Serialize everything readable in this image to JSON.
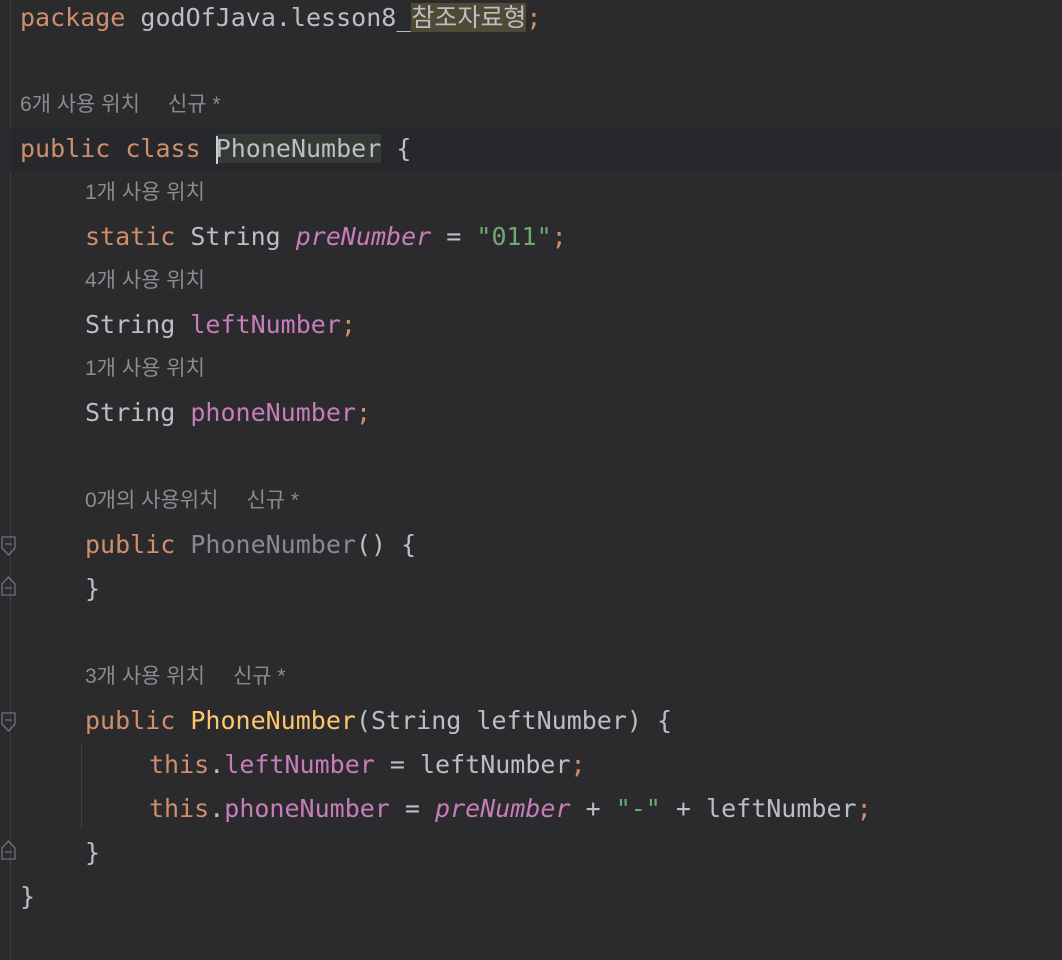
{
  "editor": {
    "package_line": {
      "keyword": "package",
      "path": "godOfJava.lesson8_",
      "highlighted": "참조자료형",
      "semicolon": ";"
    },
    "hint_class": {
      "usages": "6개 사용 위치",
      "author": "신규 *"
    },
    "class_line": {
      "kw_public": "public",
      "kw_class": "class",
      "name": "PhoneNumber",
      "brace": "{"
    },
    "hint_pre": {
      "usages": "1개 사용 위치"
    },
    "pre_line": {
      "kw_static": "static",
      "type": "String",
      "name": "preNumber",
      "eq": "=",
      "value": "\"011\"",
      "semicolon": ";"
    },
    "hint_left": {
      "usages": "4개 사용 위치"
    },
    "left_line": {
      "type": "String",
      "name": "leftNumber",
      "semicolon": ";"
    },
    "hint_phone": {
      "usages": "1개 사용 위치"
    },
    "phone_line": {
      "type": "String",
      "name": "phoneNumber",
      "semicolon": ";"
    },
    "hint_ctor1": {
      "usages": "0개의 사용위치",
      "author": "신규 *"
    },
    "ctor1_line": {
      "kw_public": "public",
      "name": "PhoneNumber",
      "rest": "() {"
    },
    "ctor1_close": {
      "brace": "}"
    },
    "hint_ctor2": {
      "usages": "3개 사용 위치",
      "author": "신규 *"
    },
    "ctor2_line": {
      "kw_public": "public",
      "name": "PhoneNumber",
      "open": "(",
      "type": "String",
      "param": "leftNumber",
      "close": ") {"
    },
    "assign1_line": {
      "kw_this": "this",
      "dot": ".",
      "field": "leftNumber",
      "eq": "=",
      "value": "leftNumber",
      "semicolon": ";"
    },
    "assign2_line": {
      "kw_this": "this",
      "dot": ".",
      "field": "phoneNumber",
      "eq": "=",
      "pre": "preNumber",
      "plus1": "+",
      "dash": "\"-\"",
      "plus2": "+",
      "value": "leftNumber",
      "semicolon": ";"
    },
    "ctor2_close": {
      "brace": "}"
    },
    "class_close": {
      "brace": "}"
    }
  },
  "colors": {
    "background": "#2b2b2d",
    "keyword": "#cf8e6d",
    "field": "#c77dbb",
    "string": "#6aab73",
    "method_declaration": "#ffc66d",
    "unused": "#868a91",
    "text": "#bcbec4",
    "hint": "#8b8c90"
  }
}
